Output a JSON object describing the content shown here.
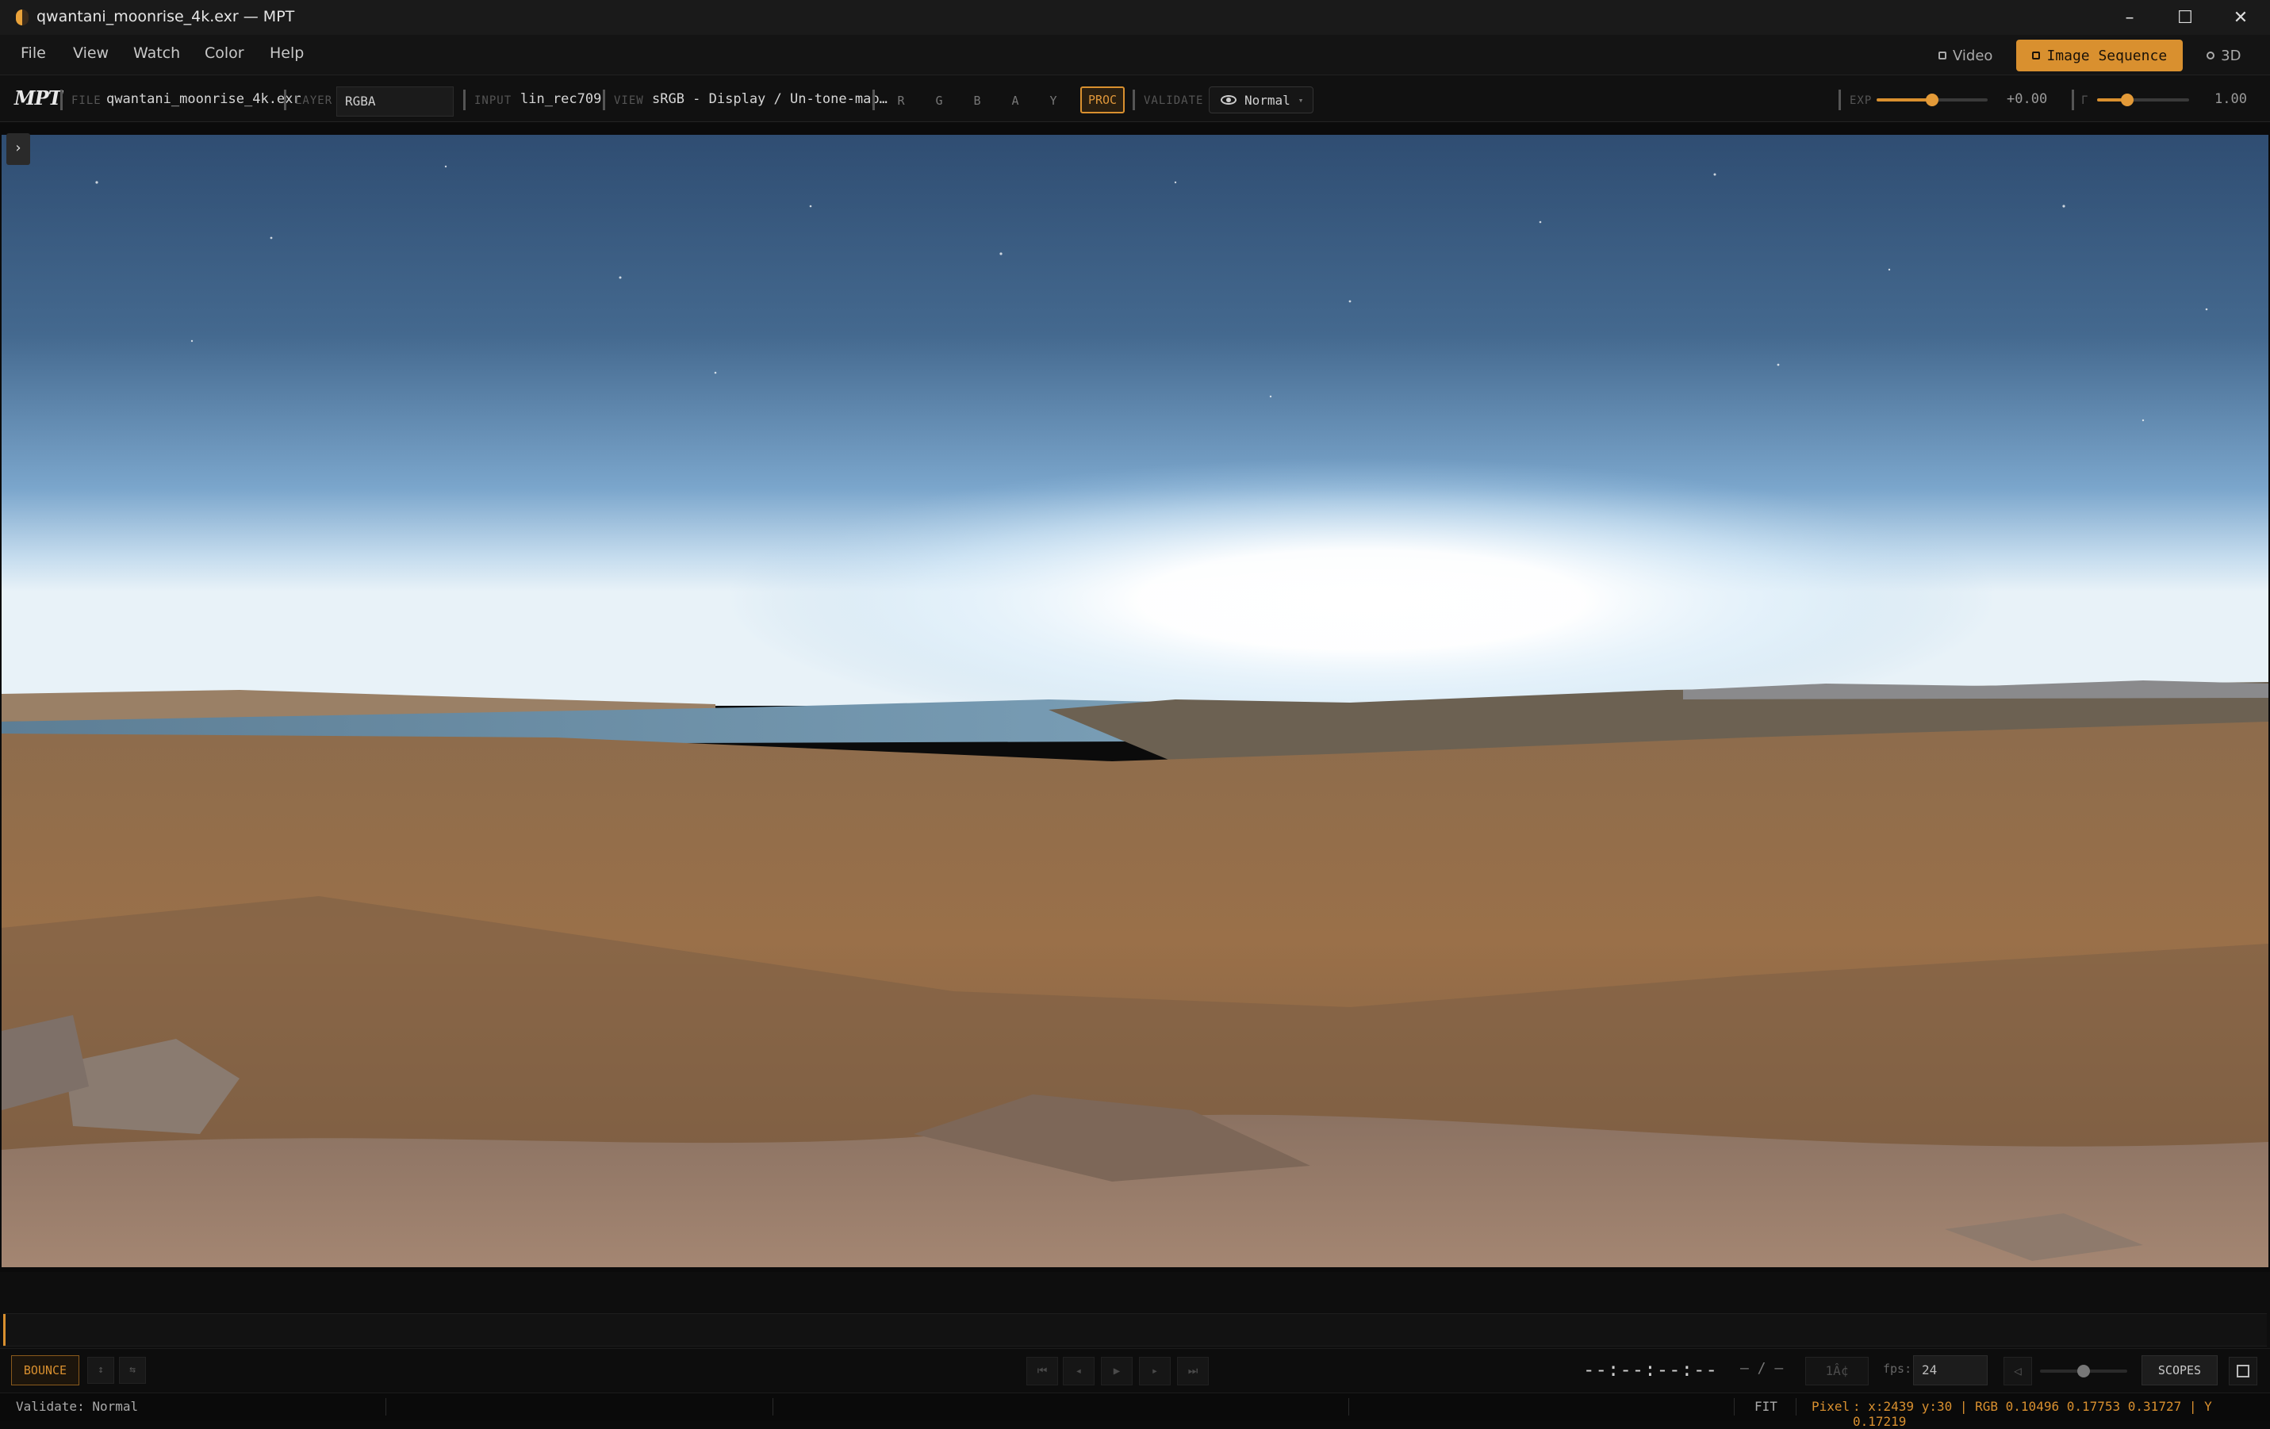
{
  "window": {
    "title": "qwantani_moonrise_4k.exr — MPT",
    "controls": [
      "–",
      "☐",
      "✕"
    ]
  },
  "menu": {
    "items": [
      "File",
      "View",
      "Watch",
      "Color",
      "Help"
    ],
    "modes": [
      {
        "label": "Video",
        "active": false
      },
      {
        "label": "Image Sequence",
        "active": true
      },
      {
        "label": "3D",
        "active": false
      }
    ]
  },
  "toolbar": {
    "logo": "MPT",
    "file_label": "FILE",
    "file_value": "qwantani_moonrise_4k.exr",
    "layer_label": "LAYER",
    "layer_value": "RGBA",
    "input_label": "INPUT",
    "input_value": "lin_rec709",
    "view_label": "VIEW",
    "view_value": "sRGB - Display / Un-tone-map…",
    "channels": [
      "R",
      "G",
      "B",
      "A",
      "Y"
    ],
    "proc_label": "PROC",
    "validate_label": "VALIDATE",
    "validate_value": "Normal",
    "exp_label": "EXP",
    "exp_value": "+0.00",
    "exp_level": 0.5,
    "gamma_label": "Γ",
    "gamma_value": "1.00",
    "gamma_level": 0.33
  },
  "viewer": {
    "panel_toggle": "›",
    "accent": "#d9902f"
  },
  "transport": {
    "bounce_label": "BOUNCE",
    "loop_icons": [
      "↕",
      "⇆"
    ],
    "buttons": [
      "⏮",
      "◂",
      "▶",
      "▸",
      "⏭"
    ],
    "timecode": "--:--:--:--",
    "frame_count": "— / —",
    "frame_placeholder": "1Â¢",
    "fps_label": "fps:",
    "fps_value": "24",
    "volume_icon": "◁",
    "volume_level": 0.5,
    "scopes_label": "SCOPES"
  },
  "status": {
    "validate": "Validate: Normal",
    "fit": "FIT",
    "mode": "Pixel",
    "readout": ": x:2439 y:30 | RGB 0.10496 0.17753 0.31727 | Y 0.17219"
  }
}
